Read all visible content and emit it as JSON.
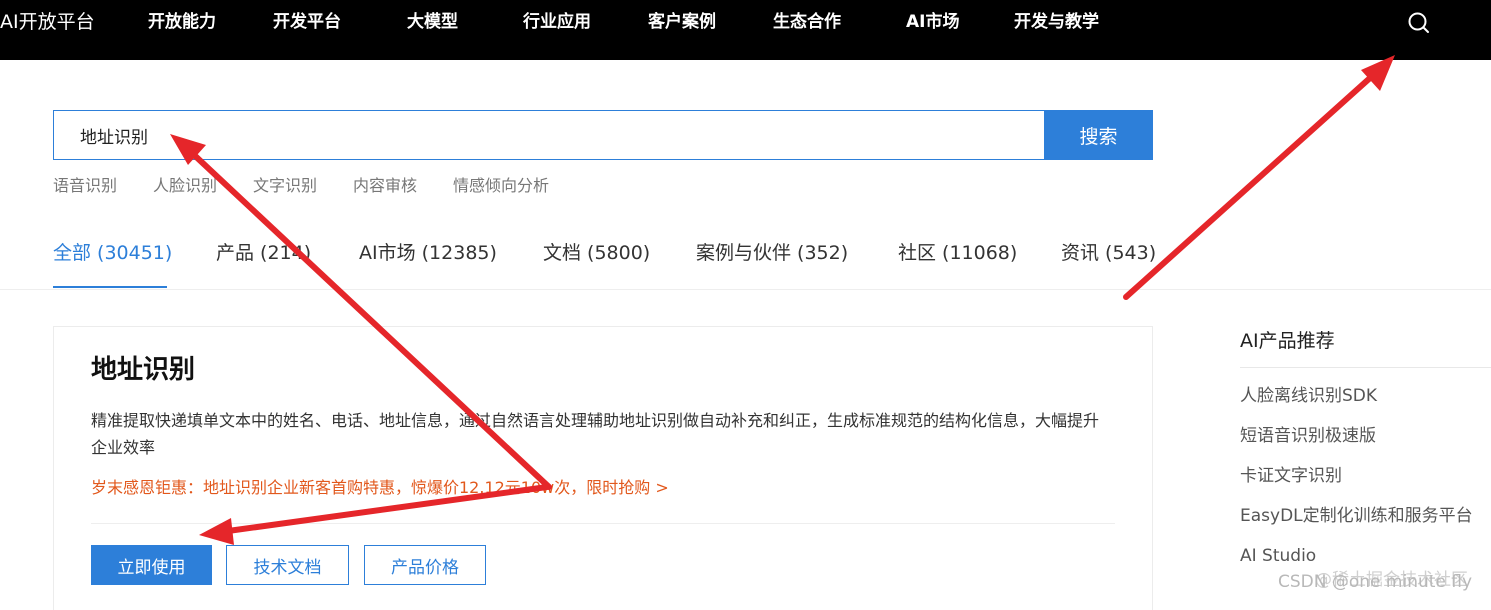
{
  "header": {
    "brand": "AI开放平台",
    "nav": [
      {
        "label": "开放能力"
      },
      {
        "label": "开发平台"
      },
      {
        "label": "大模型"
      },
      {
        "label": "行业应用"
      },
      {
        "label": "客户案例"
      },
      {
        "label": "生态合作"
      },
      {
        "label": "AI市场"
      },
      {
        "label": "开发与教学"
      }
    ],
    "search_icon": "search-icon"
  },
  "search": {
    "value": "地址识别",
    "button_label": "搜索",
    "hot_tags": [
      "语音识别",
      "人脸识别",
      "文字识别",
      "内容审核",
      "情感倾向分析"
    ]
  },
  "tabs": [
    {
      "label": "全部 (30451)",
      "active": true
    },
    {
      "label": "产品 (214)"
    },
    {
      "label": "AI市场 (12385)"
    },
    {
      "label": "文档 (5800)"
    },
    {
      "label": "案例与伙伴 (352)"
    },
    {
      "label": "社区 (11068)"
    },
    {
      "label": "资讯 (543)"
    }
  ],
  "result_card": {
    "title": "地址识别",
    "description": "精准提取快递填单文本中的姓名、电话、地址信息，通过自然语言处理辅助地址识别做自动补充和纠正，生成标准规范的结构化信息，大幅提升企业效率",
    "promo": "岁末感恩钜惠：地址识别企业新客首购特惠，惊爆价12.12元10w次，限时抢购 >",
    "buttons": {
      "use": "立即使用",
      "docs": "技术文档",
      "price": "产品价格"
    }
  },
  "sidebar": {
    "title": "AI产品推荐",
    "items": [
      "人脸离线识别SDK",
      "短语音识别极速版",
      "卡证文字识别",
      "EasyDL定制化训练和服务平台",
      "AI Studio"
    ]
  },
  "watermark": {
    "main": "CSDN @one minute fly",
    "sub": "@稀土掘金技术社区"
  },
  "colors": {
    "accent": "#2d7fd9",
    "promo": "#e2581c",
    "header_bg": "#000000",
    "annotation_arrow": "#e5262a"
  }
}
